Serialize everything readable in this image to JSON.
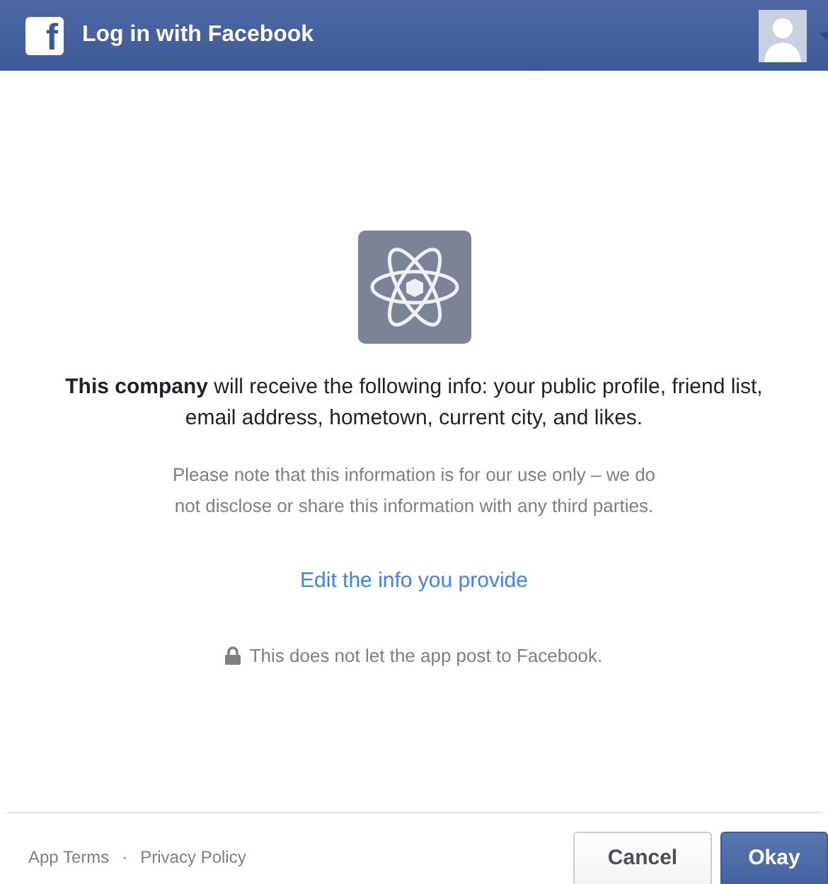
{
  "header": {
    "logo_letter": "f",
    "title": "Log in with Facebook"
  },
  "body": {
    "permissions": "**This company** will receive the following info: your public profile, friend list, email address, hometown, current city, and likes.",
    "note": "Please note that this information is for our use only – we do not disclose or share this information with any third parties.",
    "edit_link": "Edit the info you provide",
    "post_notice": "This does not let the app post to Facebook."
  },
  "footer": {
    "links": [
      "App Terms",
      "Privacy Policy"
    ],
    "separator": "·",
    "buttons": [
      {
        "label": "Cancel",
        "kind": "secondary"
      },
      {
        "label": "Okay",
        "kind": "primary"
      }
    ]
  }
}
